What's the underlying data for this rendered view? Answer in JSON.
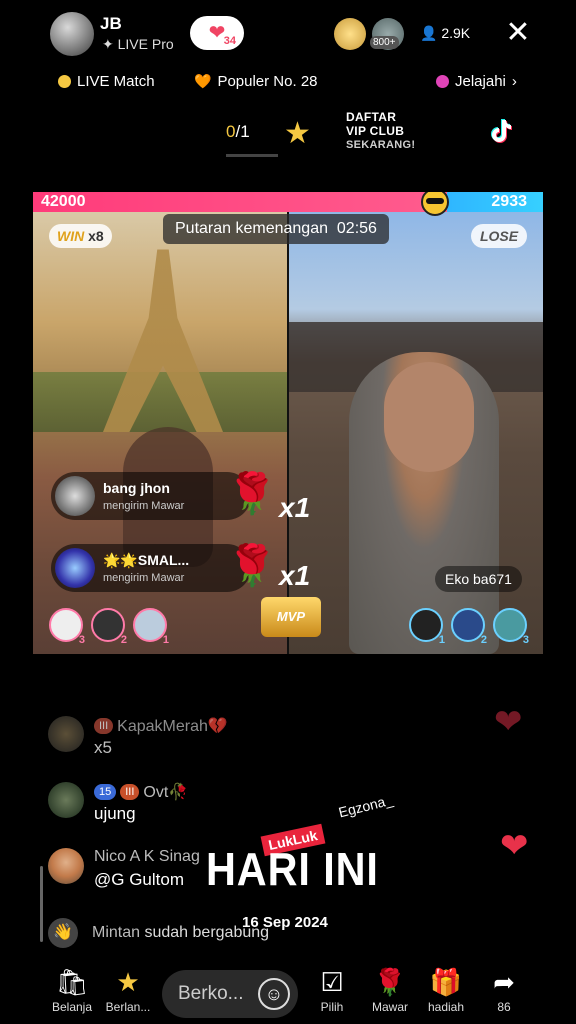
{
  "header": {
    "host_name": "JB",
    "host_badge": "LIVE Pro",
    "likes_count": "34",
    "viewer_level": "800+",
    "viewer_count": "2.9K"
  },
  "nav_row": {
    "live_match": "LIVE Match",
    "populer": "Populer No. 28",
    "jelajahi": "Jelajahi"
  },
  "promo_row": {
    "counter_current": "0",
    "counter_total": "/1",
    "vip_line1": "DAFTAR",
    "vip_line2": "VIP CLUB",
    "vip_line3": "SEKARANG!"
  },
  "battle": {
    "left_score": "42000",
    "right_score": "2933",
    "timer_label": "Putaran kemenangan",
    "timer_value": "02:56",
    "win_label": "WIN",
    "win_mult": "x8",
    "lose_label": "LOSE",
    "opponent_name": "Eko ba671",
    "mvp_label": "MVP",
    "gifts": [
      {
        "name": "bang jhon",
        "action": "mengirim Mawar",
        "combo": "x1"
      },
      {
        "name": "🌟🌟SMAL...",
        "action": "mengirim Mawar",
        "combo": "x1"
      }
    ],
    "left_ranks": [
      "3",
      "2",
      "1"
    ],
    "right_ranks": [
      "1",
      "2",
      "3"
    ]
  },
  "chat": [
    {
      "name": "KapakMerah💔",
      "badge": "III",
      "msg": "x5"
    },
    {
      "name": "Ovt🥀",
      "badge1": "15",
      "badge2": "III",
      "msg": "ujung"
    },
    {
      "name": "Nico A K Sinag",
      "msg": "@G Gultom"
    },
    {
      "name": "Mintan",
      "msg": "sudah bergabung"
    }
  ],
  "overlay": {
    "tag": "LukLuk",
    "handle": "Egzona_",
    "title": "HARI INI",
    "date": "16 Sep 2024"
  },
  "bottom_bar": {
    "belanja": "Belanja",
    "berlangganan": "Berlan...",
    "comment_placeholder": "Berko...",
    "pilih": "Pilih",
    "mawar": "Mawar",
    "hadiah": "hadiah",
    "share_count": "86"
  },
  "colors": {
    "left_team": "#ff3b7a",
    "right_team": "#2fb6ff",
    "gold": "#f5c842",
    "rose": "#e8324a"
  }
}
